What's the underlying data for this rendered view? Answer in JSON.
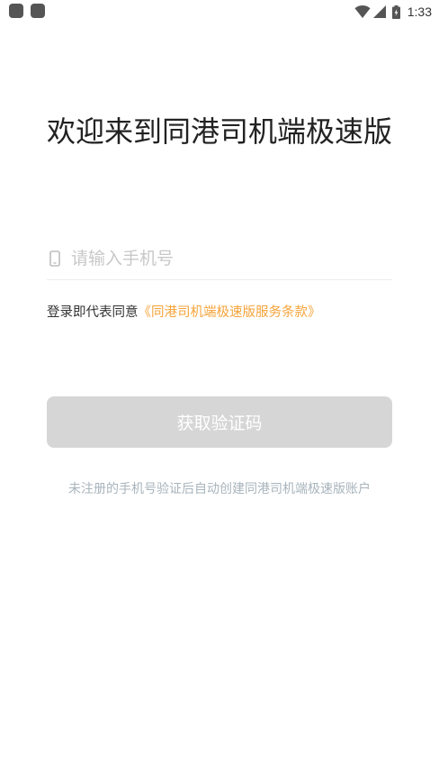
{
  "status_bar": {
    "time": "1:33",
    "icons": [
      "notification-icon",
      "notification-icon",
      "wifi-icon",
      "cell-signal-icon",
      "battery-icon"
    ]
  },
  "login": {
    "title": "欢迎来到同港司机端极速版",
    "phone_placeholder": "请输入手机号",
    "phone_value": "",
    "agreement_prefix": "登录即代表同意",
    "agreement_link": "《同港司机端极速版服务条款》",
    "verify_button": "获取验证码",
    "hint": "未注册的手机号验证后自动创建同港司机端极速版账户"
  },
  "colors": {
    "link": "#f5a33a",
    "button_disabled": "#d6d6d6",
    "hint_text": "#a8b4bc"
  }
}
